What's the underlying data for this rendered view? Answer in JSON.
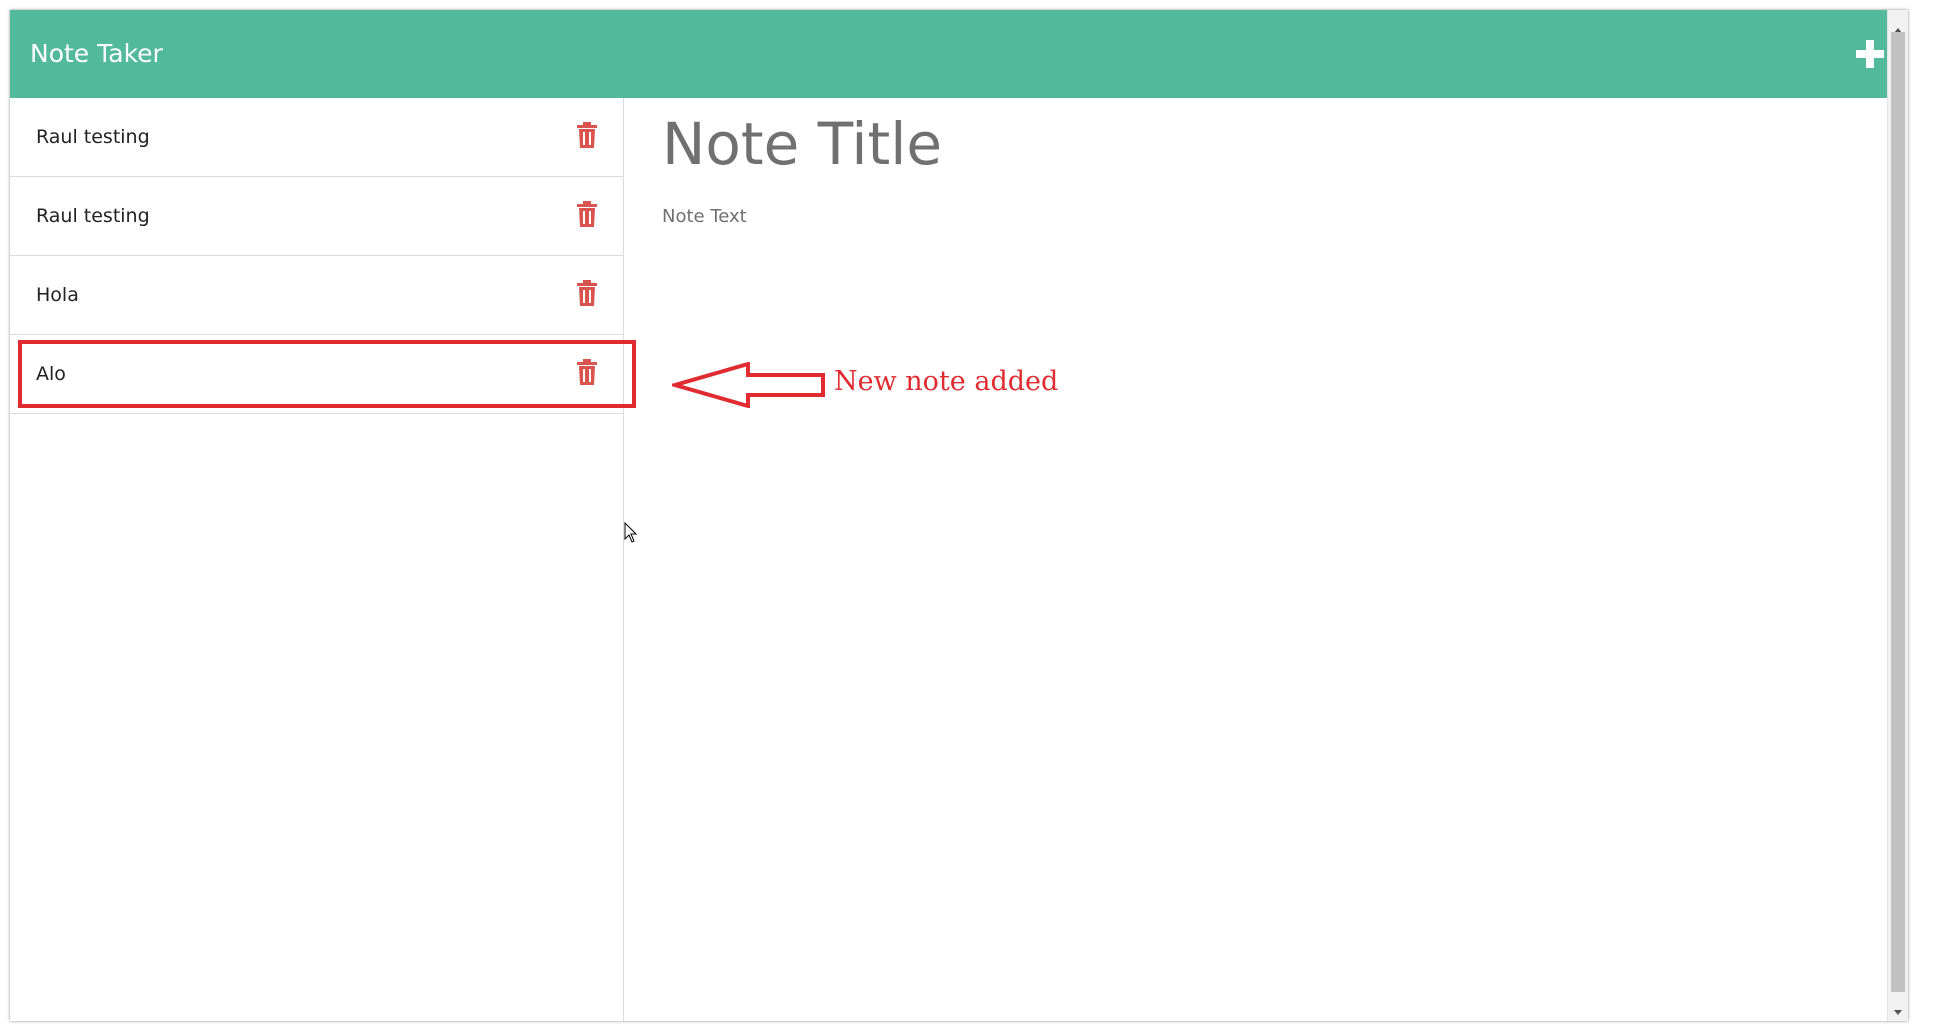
{
  "app": {
    "title": "Note Taker",
    "add_button_icon": "plus-icon",
    "brand_color": "#52b99b"
  },
  "notes": [
    {
      "title": "Raul testing",
      "delete_icon": "trash-icon"
    },
    {
      "title": "Raul testing",
      "delete_icon": "trash-icon"
    },
    {
      "title": "Hola",
      "delete_icon": "trash-icon"
    },
    {
      "title": "Alo",
      "delete_icon": "trash-icon"
    }
  ],
  "editor": {
    "title_placeholder": "Note Title",
    "text_placeholder": "Note Text",
    "title_value": "",
    "text_value": ""
  },
  "annotation": {
    "text": "New note added",
    "color": "#e02c31"
  },
  "colors": {
    "delete_icon": "#d9534f",
    "highlight": "#e02c31"
  }
}
